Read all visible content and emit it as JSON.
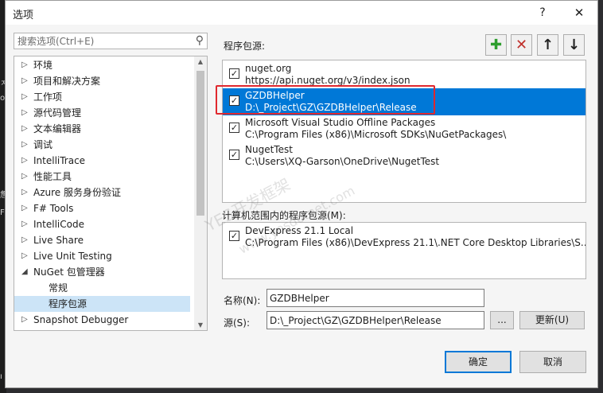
{
  "dialog": {
    "title": "选项",
    "help_label": "?",
    "close_label": "✕"
  },
  "search": {
    "placeholder": "搜索选项(Ctrl+E)"
  },
  "tree": {
    "items": [
      {
        "label": "环境",
        "arrow": "▷"
      },
      {
        "label": "项目和解决方案",
        "arrow": "▷"
      },
      {
        "label": "工作项",
        "arrow": "▷"
      },
      {
        "label": "源代码管理",
        "arrow": "▷"
      },
      {
        "label": "文本编辑器",
        "arrow": "▷"
      },
      {
        "label": "调试",
        "arrow": "▷"
      },
      {
        "label": "IntelliTrace",
        "arrow": "▷"
      },
      {
        "label": "性能工具",
        "arrow": "▷"
      },
      {
        "label": "Azure 服务身份验证",
        "arrow": "▷"
      },
      {
        "label": "F# Tools",
        "arrow": "▷"
      },
      {
        "label": "IntelliCode",
        "arrow": "▷"
      },
      {
        "label": "Live Share",
        "arrow": "▷"
      },
      {
        "label": "Live Unit Testing",
        "arrow": "▷"
      },
      {
        "label": "NuGet 包管理器",
        "arrow": "◢"
      },
      {
        "label": "常规",
        "arrow": ""
      },
      {
        "label": "程序包源",
        "arrow": ""
      },
      {
        "label": "Snapshot Debugger",
        "arrow": "▷"
      }
    ],
    "selected_index": 15
  },
  "package_sources": {
    "label": "程序包源:",
    "toolbar": {
      "add": "✚",
      "remove": "✕",
      "up": "↑",
      "down": "↓"
    },
    "items": [
      {
        "name": "nuget.org",
        "url": "https://api.nuget.org/v3/index.json",
        "checked": true
      },
      {
        "name": "GZDBHelper",
        "url": "D:\\_Project\\GZ\\GZDBHelper\\Release",
        "checked": true
      },
      {
        "name": "Microsoft Visual Studio Offline Packages",
        "url": "C:\\Program Files (x86)\\Microsoft SDKs\\NuGetPackages\\",
        "checked": true
      },
      {
        "name": "NugetTest",
        "url": "C:\\Users\\XQ-Garson\\OneDrive\\NugetTest",
        "checked": true
      }
    ],
    "selected_index": 1
  },
  "machine_sources": {
    "label": "计算机范围内的程序包源(M):",
    "items": [
      {
        "name": "DevExpress 21.1 Local",
        "url": "C:\\Program Files (x86)\\DevExpress 21.1\\.NET Core Desktop Libraries\\S...",
        "checked": true
      }
    ]
  },
  "form": {
    "name_label": "名称(N):",
    "name_value": "GZDBHelper",
    "source_label": "源(S):",
    "source_value": "D:\\_Project\\GZ\\GZDBHelper\\Release",
    "browse_label": "...",
    "update_label": "更新(U)"
  },
  "footer": {
    "ok_label": "确定",
    "cancel_label": "取消"
  },
  "check_glyph": "✓",
  "watermark": {
    "line1": "YES开发框架",
    "line2": "www.yesdotnet.com"
  },
  "colors": {
    "selection": "#0078d7",
    "tree_selection": "#cce4f7",
    "highlight_border": "#e0282e",
    "add_green": "#2e9e2e",
    "remove_red": "#c0302b"
  }
}
